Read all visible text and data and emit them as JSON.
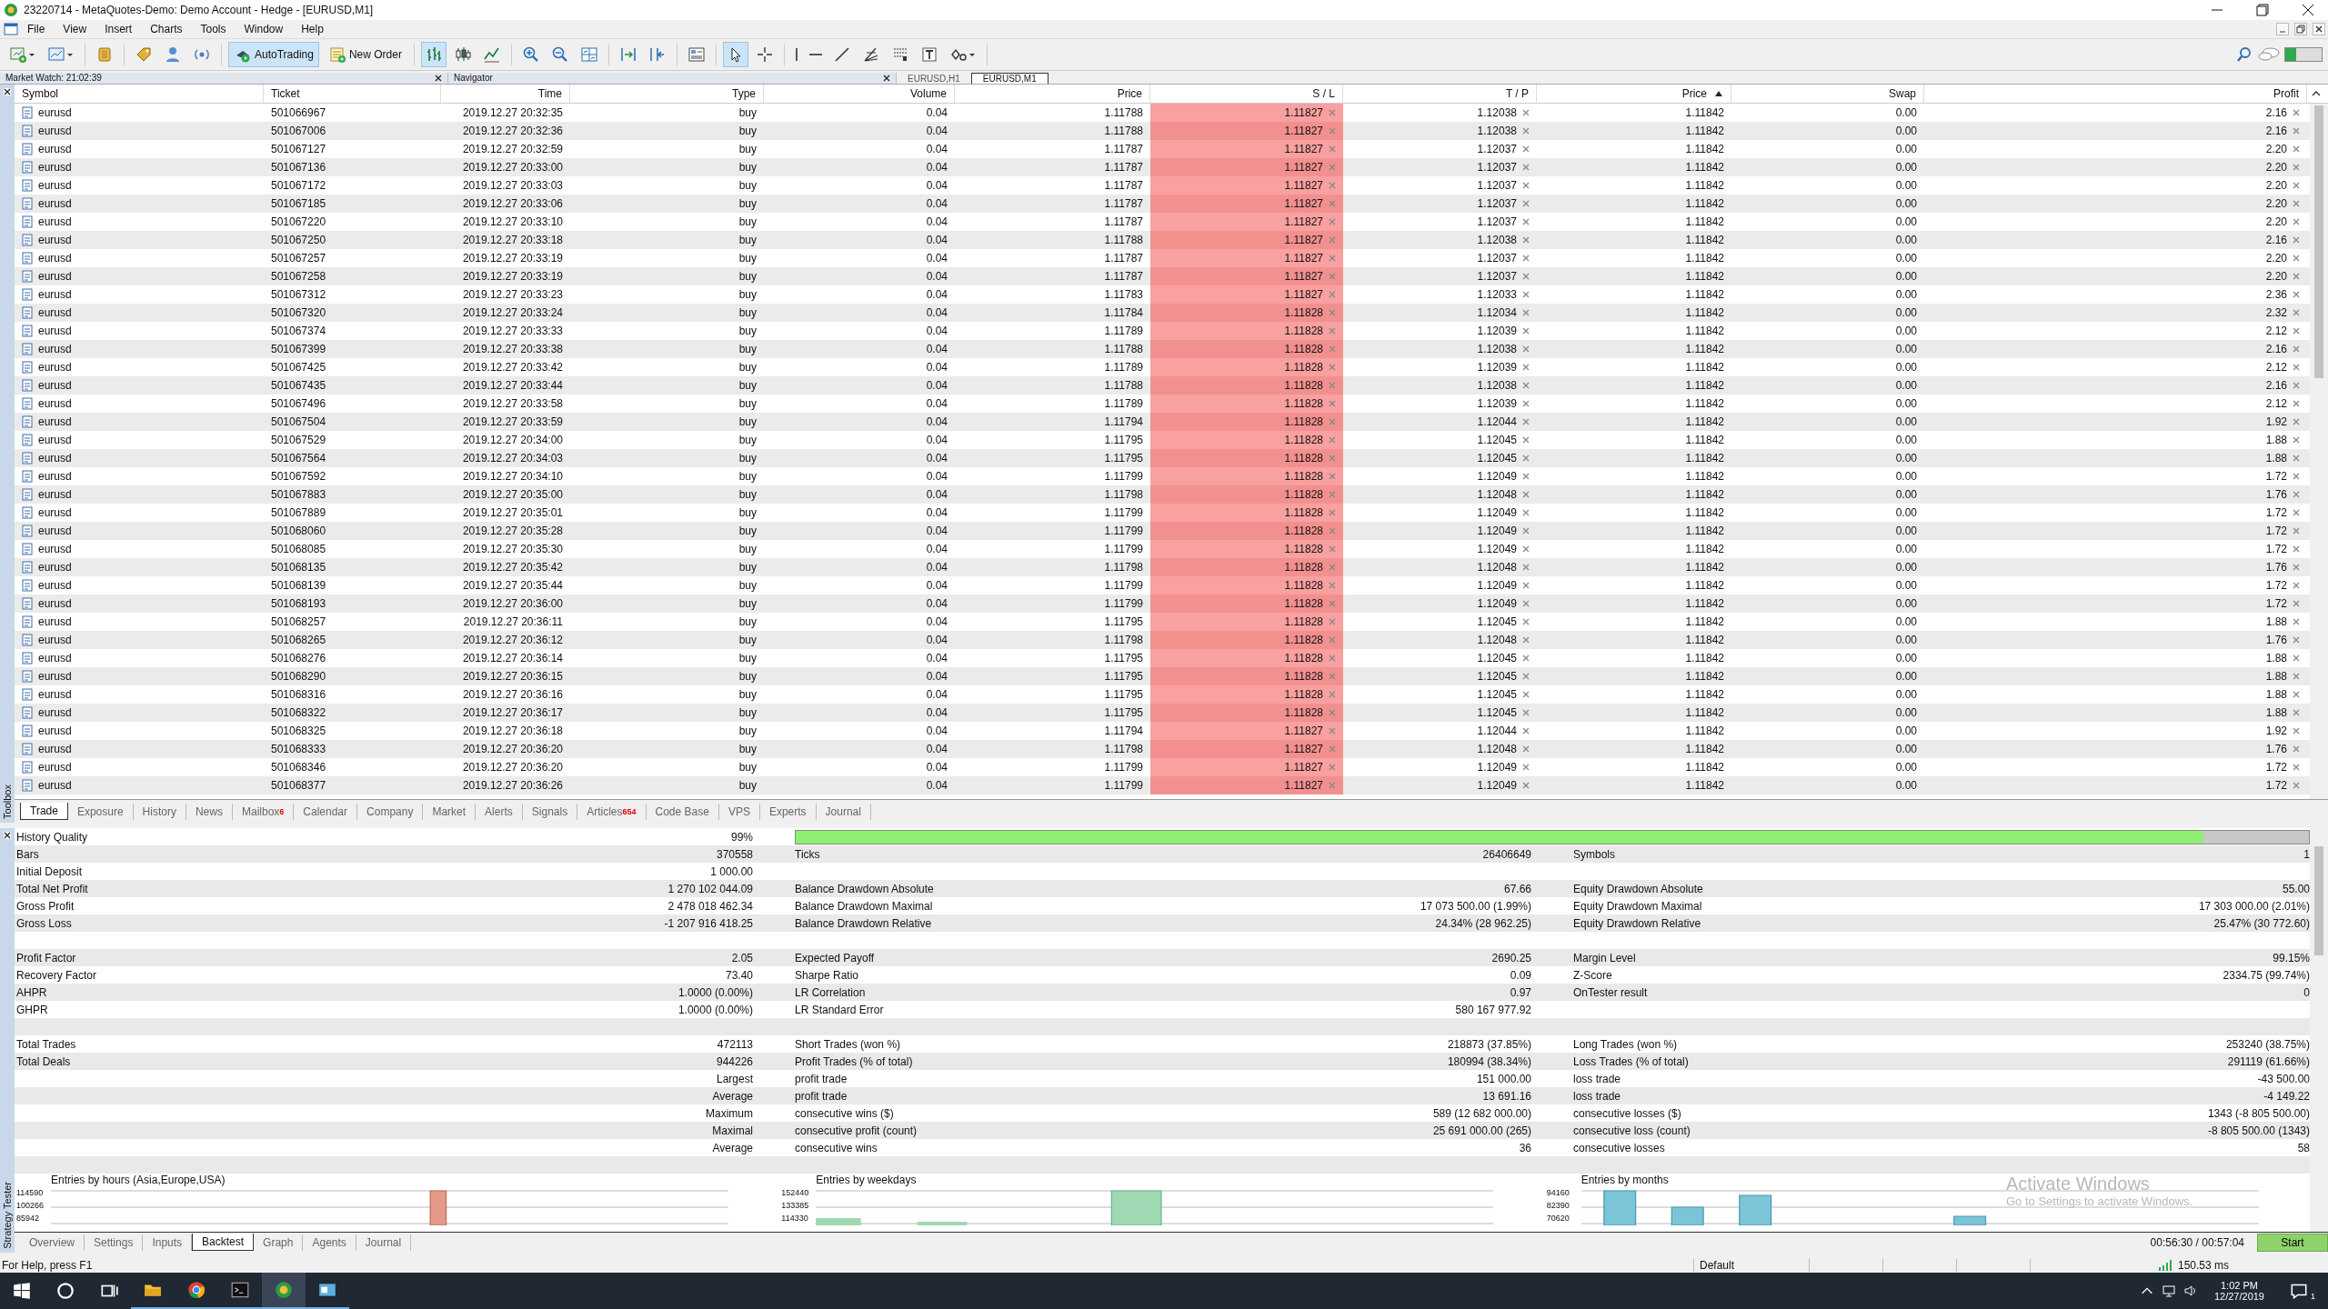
{
  "window": {
    "title": "23220714 - MetaQuotes-Demo: Demo Account - Hedge - [EURUSD,M1]"
  },
  "menu": [
    "File",
    "View",
    "Insert",
    "Charts",
    "Tools",
    "Window",
    "Help"
  ],
  "toolbar": [
    [
      {
        "kind": "icon",
        "selected": false
      },
      {
        "kind": "icon",
        "selected": false
      }
    ],
    [
      {
        "kind": "icon",
        "selected": false
      }
    ],
    [
      {
        "kind": "icon",
        "selected": false
      },
      {
        "kind": "icon",
        "selected": false
      },
      {
        "kind": "icon",
        "selected": false
      }
    ],
    [
      {
        "kind": "button",
        "label": "AutoTrading",
        "selected": true
      },
      {
        "kind": "button",
        "label": "New Order",
        "selected": false
      }
    ],
    [
      {
        "kind": "icon",
        "selected": true
      },
      {
        "kind": "icon",
        "selected": false
      },
      {
        "kind": "icon",
        "selected": false
      }
    ],
    [
      {
        "kind": "icon",
        "selected": false
      },
      {
        "kind": "icon",
        "selected": false
      },
      {
        "kind": "icon",
        "selected": false
      }
    ],
    [
      {
        "kind": "icon",
        "selected": false
      },
      {
        "kind": "icon",
        "selected": false
      }
    ],
    [
      {
        "kind": "icon",
        "selected": false
      }
    ],
    [
      {
        "kind": "icon",
        "selected": true
      },
      {
        "kind": "icon",
        "selected": false
      }
    ],
    [
      {
        "kind": "icon",
        "selected": false
      },
      {
        "kind": "icon",
        "selected": false
      },
      {
        "kind": "icon",
        "selected": false
      },
      {
        "kind": "icon",
        "selected": false
      },
      {
        "kind": "icon",
        "selected": false
      },
      {
        "kind": "icon",
        "selected": false
      },
      {
        "kind": "icon",
        "selected": false
      }
    ]
  ],
  "panels": [
    {
      "title": "Market Watch: 21:02:39"
    },
    {
      "title": "Navigator"
    }
  ],
  "chart_tabs": [
    {
      "label": "EURUSD,H1",
      "selected": false
    },
    {
      "label": "EURUSD,M1",
      "selected": true
    }
  ],
  "side_labels": {
    "toolbox": "Toolbox",
    "tester": "Strategy Tester"
  },
  "columns": [
    {
      "label": "Symbol",
      "sorted": false,
      "highlighted": false,
      "clear_button": false
    },
    {
      "label": "Ticket",
      "sorted": false,
      "highlighted": false,
      "clear_button": false
    },
    {
      "label": "Time",
      "sorted": false,
      "highlighted": false,
      "clear_button": false
    },
    {
      "label": "Type",
      "sorted": false,
      "highlighted": false,
      "clear_button": false
    },
    {
      "label": "Volume",
      "sorted": false,
      "highlighted": false,
      "clear_button": false
    },
    {
      "label": "Price",
      "sorted": false,
      "highlighted": false,
      "clear_button": false
    },
    {
      "label": "S / L",
      "sorted": false,
      "highlighted": true,
      "clear_button": true
    },
    {
      "label": "T / P",
      "sorted": false,
      "highlighted": false,
      "clear_button": true
    },
    {
      "label": "Price",
      "sorted": true,
      "highlighted": false,
      "clear_button": false
    },
    {
      "label": "Swap",
      "sorted": false,
      "highlighted": false,
      "clear_button": false
    },
    {
      "label": "Profit",
      "sorted": false,
      "highlighted": false,
      "clear_button": true
    }
  ],
  "rows": [
    [
      "eurusd",
      "501066967",
      "2019.12.27 20:32:35",
      "buy",
      "0.04",
      "1.11788",
      "1.11827",
      "1.12038",
      "1.11842",
      "0.00",
      "2.16"
    ],
    [
      "eurusd",
      "501067006",
      "2019.12.27 20:32:36",
      "buy",
      "0.04",
      "1.11788",
      "1.11827",
      "1.12038",
      "1.11842",
      "0.00",
      "2.16"
    ],
    [
      "eurusd",
      "501067127",
      "2019.12.27 20:32:59",
      "buy",
      "0.04",
      "1.11787",
      "1.11827",
      "1.12037",
      "1.11842",
      "0.00",
      "2.20"
    ],
    [
      "eurusd",
      "501067136",
      "2019.12.27 20:33:00",
      "buy",
      "0.04",
      "1.11787",
      "1.11827",
      "1.12037",
      "1.11842",
      "0.00",
      "2.20"
    ],
    [
      "eurusd",
      "501067172",
      "2019.12.27 20:33:03",
      "buy",
      "0.04",
      "1.11787",
      "1.11827",
      "1.12037",
      "1.11842",
      "0.00",
      "2.20"
    ],
    [
      "eurusd",
      "501067185",
      "2019.12.27 20:33:06",
      "buy",
      "0.04",
      "1.11787",
      "1.11827",
      "1.12037",
      "1.11842",
      "0.00",
      "2.20"
    ],
    [
      "eurusd",
      "501067220",
      "2019.12.27 20:33:10",
      "buy",
      "0.04",
      "1.11787",
      "1.11827",
      "1.12037",
      "1.11842",
      "0.00",
      "2.20"
    ],
    [
      "eurusd",
      "501067250",
      "2019.12.27 20:33:18",
      "buy",
      "0.04",
      "1.11788",
      "1.11827",
      "1.12038",
      "1.11842",
      "0.00",
      "2.16"
    ],
    [
      "eurusd",
      "501067257",
      "2019.12.27 20:33:19",
      "buy",
      "0.04",
      "1.11787",
      "1.11827",
      "1.12037",
      "1.11842",
      "0.00",
      "2.20"
    ],
    [
      "eurusd",
      "501067258",
      "2019.12.27 20:33:19",
      "buy",
      "0.04",
      "1.11787",
      "1.11827",
      "1.12037",
      "1.11842",
      "0.00",
      "2.20"
    ],
    [
      "eurusd",
      "501067312",
      "2019.12.27 20:33:23",
      "buy",
      "0.04",
      "1.11783",
      "1.11827",
      "1.12033",
      "1.11842",
      "0.00",
      "2.36"
    ],
    [
      "eurusd",
      "501067320",
      "2019.12.27 20:33:24",
      "buy",
      "0.04",
      "1.11784",
      "1.11828",
      "1.12034",
      "1.11842",
      "0.00",
      "2.32"
    ],
    [
      "eurusd",
      "501067374",
      "2019.12.27 20:33:33",
      "buy",
      "0.04",
      "1.11789",
      "1.11828",
      "1.12039",
      "1.11842",
      "0.00",
      "2.12"
    ],
    [
      "eurusd",
      "501067399",
      "2019.12.27 20:33:38",
      "buy",
      "0.04",
      "1.11788",
      "1.11828",
      "1.12038",
      "1.11842",
      "0.00",
      "2.16"
    ],
    [
      "eurusd",
      "501067425",
      "2019.12.27 20:33:42",
      "buy",
      "0.04",
      "1.11789",
      "1.11828",
      "1.12039",
      "1.11842",
      "0.00",
      "2.12"
    ],
    [
      "eurusd",
      "501067435",
      "2019.12.27 20:33:44",
      "buy",
      "0.04",
      "1.11788",
      "1.11828",
      "1.12038",
      "1.11842",
      "0.00",
      "2.16"
    ],
    [
      "eurusd",
      "501067496",
      "2019.12.27 20:33:58",
      "buy",
      "0.04",
      "1.11789",
      "1.11828",
      "1.12039",
      "1.11842",
      "0.00",
      "2.12"
    ],
    [
      "eurusd",
      "501067504",
      "2019.12.27 20:33:59",
      "buy",
      "0.04",
      "1.11794",
      "1.11828",
      "1.12044",
      "1.11842",
      "0.00",
      "1.92"
    ],
    [
      "eurusd",
      "501067529",
      "2019.12.27 20:34:00",
      "buy",
      "0.04",
      "1.11795",
      "1.11828",
      "1.12045",
      "1.11842",
      "0.00",
      "1.88"
    ],
    [
      "eurusd",
      "501067564",
      "2019.12.27 20:34:03",
      "buy",
      "0.04",
      "1.11795",
      "1.11828",
      "1.12045",
      "1.11842",
      "0.00",
      "1.88"
    ],
    [
      "eurusd",
      "501067592",
      "2019.12.27 20:34:10",
      "buy",
      "0.04",
      "1.11799",
      "1.11828",
      "1.12049",
      "1.11842",
      "0.00",
      "1.72"
    ],
    [
      "eurusd",
      "501067883",
      "2019.12.27 20:35:00",
      "buy",
      "0.04",
      "1.11798",
      "1.11828",
      "1.12048",
      "1.11842",
      "0.00",
      "1.76"
    ],
    [
      "eurusd",
      "501067889",
      "2019.12.27 20:35:01",
      "buy",
      "0.04",
      "1.11799",
      "1.11828",
      "1.12049",
      "1.11842",
      "0.00",
      "1.72"
    ],
    [
      "eurusd",
      "501068060",
      "2019.12.27 20:35:28",
      "buy",
      "0.04",
      "1.11799",
      "1.11828",
      "1.12049",
      "1.11842",
      "0.00",
      "1.72"
    ],
    [
      "eurusd",
      "501068085",
      "2019.12.27 20:35:30",
      "buy",
      "0.04",
      "1.11799",
      "1.11828",
      "1.12049",
      "1.11842",
      "0.00",
      "1.72"
    ],
    [
      "eurusd",
      "501068135",
      "2019.12.27 20:35:42",
      "buy",
      "0.04",
      "1.11798",
      "1.11828",
      "1.12048",
      "1.11842",
      "0.00",
      "1.76"
    ],
    [
      "eurusd",
      "501068139",
      "2019.12.27 20:35:44",
      "buy",
      "0.04",
      "1.11799",
      "1.11828",
      "1.12049",
      "1.11842",
      "0.00",
      "1.72"
    ],
    [
      "eurusd",
      "501068193",
      "2019.12.27 20:36:00",
      "buy",
      "0.04",
      "1.11799",
      "1.11828",
      "1.12049",
      "1.11842",
      "0.00",
      "1.72"
    ],
    [
      "eurusd",
      "501068257",
      "2019.12.27 20:36:11",
      "buy",
      "0.04",
      "1.11795",
      "1.11828",
      "1.12045",
      "1.11842",
      "0.00",
      "1.88"
    ],
    [
      "eurusd",
      "501068265",
      "2019.12.27 20:36:12",
      "buy",
      "0.04",
      "1.11798",
      "1.11828",
      "1.12048",
      "1.11842",
      "0.00",
      "1.76"
    ],
    [
      "eurusd",
      "501068276",
      "2019.12.27 20:36:14",
      "buy",
      "0.04",
      "1.11795",
      "1.11828",
      "1.12045",
      "1.11842",
      "0.00",
      "1.88"
    ],
    [
      "eurusd",
      "501068290",
      "2019.12.27 20:36:15",
      "buy",
      "0.04",
      "1.11795",
      "1.11828",
      "1.12045",
      "1.11842",
      "0.00",
      "1.88"
    ],
    [
      "eurusd",
      "501068316",
      "2019.12.27 20:36:16",
      "buy",
      "0.04",
      "1.11795",
      "1.11828",
      "1.12045",
      "1.11842",
      "0.00",
      "1.88"
    ],
    [
      "eurusd",
      "501068322",
      "2019.12.27 20:36:17",
      "buy",
      "0.04",
      "1.11795",
      "1.11828",
      "1.12045",
      "1.11842",
      "0.00",
      "1.88"
    ],
    [
      "eurusd",
      "501068325",
      "2019.12.27 20:36:18",
      "buy",
      "0.04",
      "1.11794",
      "1.11827",
      "1.12044",
      "1.11842",
      "0.00",
      "1.92"
    ],
    [
      "eurusd",
      "501068333",
      "2019.12.27 20:36:20",
      "buy",
      "0.04",
      "1.11798",
      "1.11827",
      "1.12048",
      "1.11842",
      "0.00",
      "1.76"
    ],
    [
      "eurusd",
      "501068346",
      "2019.12.27 20:36:20",
      "buy",
      "0.04",
      "1.11799",
      "1.11827",
      "1.12049",
      "1.11842",
      "0.00",
      "1.72"
    ],
    [
      "eurusd",
      "501068377",
      "2019.12.27 20:36:26",
      "buy",
      "0.04",
      "1.11799",
      "1.11827",
      "1.12049",
      "1.11842",
      "0.00",
      "1.72"
    ]
  ],
  "toolbox_tabs": [
    {
      "label": "Trade",
      "selected": true
    },
    {
      "label": "Exposure",
      "selected": false
    },
    {
      "label": "History",
      "selected": false
    },
    {
      "label": "News",
      "selected": false
    },
    {
      "label": "Mailbox",
      "badge": "6",
      "selected": false
    },
    {
      "label": "Calendar",
      "selected": false
    },
    {
      "label": "Company",
      "selected": false
    },
    {
      "label": "Market",
      "selected": false
    },
    {
      "label": "Alerts",
      "selected": false
    },
    {
      "label": "Signals",
      "selected": false
    },
    {
      "label": "Articles",
      "badge": "654",
      "selected": false
    },
    {
      "label": "Code Base",
      "selected": false
    },
    {
      "label": "VPS",
      "selected": false
    },
    {
      "label": "Experts",
      "selected": false
    },
    {
      "label": "Journal",
      "selected": false
    }
  ],
  "stats": [
    {
      "kind": "quality",
      "l1": "History Quality",
      "v1": "99%",
      "level": 0.93
    },
    {
      "kind": "data",
      "l1": "Bars",
      "v1": "370558",
      "l2": "Ticks",
      "v2": "26406649",
      "l3": "Symbols",
      "v3": "1"
    },
    {
      "kind": "data",
      "l1": "Initial Deposit",
      "v1": "1 000.00"
    },
    {
      "kind": "data",
      "l1": "Total Net Profit",
      "v1": "1 270 102 044.09",
      "l2": "Balance Drawdown Absolute",
      "v2": "67.66",
      "l3": "Equity Drawdown Absolute",
      "v3": "55.00"
    },
    {
      "kind": "data",
      "l1": "Gross Profit",
      "v1": "2 478 018 462.34",
      "l2": "Balance Drawdown Maximal",
      "v2": "17 073 500.00 (1.99%)",
      "l3": "Equity Drawdown Maximal",
      "v3": "17 303 000.00 (2.01%)"
    },
    {
      "kind": "data",
      "l1": "Gross Loss",
      "v1": "-1 207 916 418.25",
      "l2": "Balance Drawdown Relative",
      "v2": "24.34% (28 962.25)",
      "l3": "Equity Drawdown Relative",
      "v3": "25.47% (30 772.60)"
    },
    {
      "kind": "spacer"
    },
    {
      "kind": "data",
      "l1": "Profit Factor",
      "v1": "2.05",
      "l2": "Expected Payoff",
      "v2": "2690.25",
      "l3": "Margin Level",
      "v3": "99.15%"
    },
    {
      "kind": "data",
      "l1": "Recovery Factor",
      "v1": "73.40",
      "l2": "Sharpe Ratio",
      "v2": "0.09",
      "l3": "Z-Score",
      "v3": "2334.75 (99.74%)"
    },
    {
      "kind": "data",
      "l1": "AHPR",
      "v1": "1.0000 (0.00%)",
      "l2": "LR Correlation",
      "v2": "0.97",
      "l3": "OnTester result",
      "v3": "0"
    },
    {
      "kind": "data",
      "l1": "GHPR",
      "v1": "1.0000 (0.00%)",
      "l2": "LR Standard Error",
      "v2": "580 167 977.92"
    },
    {
      "kind": "spacer"
    },
    {
      "kind": "data",
      "l1": "Total Trades",
      "v1": "472113",
      "l2": "Short Trades (won %)",
      "v2": "218873 (37.85%)",
      "l3": "Long Trades (won %)",
      "v3": "253240 (38.75%)"
    },
    {
      "kind": "data",
      "l1": "Total Deals",
      "v1": "944226",
      "l2": "Profit Trades (% of total)",
      "v2": "180994 (38.34%)",
      "l3": "Loss Trades (% of total)",
      "v3": "291119 (61.66%)"
    },
    {
      "kind": "data",
      "v1": "Largest",
      "l2": "profit trade",
      "v2": "151 000.00",
      "l3": "loss trade",
      "v3": "-43 500.00"
    },
    {
      "kind": "data",
      "v1": "Average",
      "l2": "profit trade",
      "v2": "13 691.16",
      "l3": "loss trade",
      "v3": "-4 149.22"
    },
    {
      "kind": "data",
      "v1": "Maximum",
      "l2": "consecutive wins ($)",
      "v2": "589 (12 682 000.00)",
      "l3": "consecutive losses ($)",
      "v3": "1343 (-8 805 500.00)"
    },
    {
      "kind": "data",
      "v1": "Maximal",
      "l2": "consecutive profit (count)",
      "v2": "25 691 000.00 (265)",
      "l3": "consecutive loss (count)",
      "v3": "-8 805 500.00 (1343)"
    },
    {
      "kind": "data",
      "v1": "Average",
      "l2": "consecutive wins",
      "v2": "36",
      "l3": "consecutive losses",
      "v3": "58"
    },
    {
      "kind": "spacer"
    }
  ],
  "mini_charts": [
    {
      "title": "Entries by hours (Asia,Europe,USA)",
      "ticks": [
        "114590",
        "100266",
        "85942"
      ]
    },
    {
      "title": "Entries by weekdays",
      "ticks": [
        "152440",
        "133385",
        "114330"
      ]
    },
    {
      "title": "Entries by months",
      "ticks": [
        "94160",
        "82390",
        "70620"
      ]
    }
  ],
  "os_notice": {
    "title": "Activate Windows",
    "text": "Go to Settings to activate Windows."
  },
  "tester_tabs": [
    {
      "label": "Overview",
      "selected": false
    },
    {
      "label": "Settings",
      "selected": false
    },
    {
      "label": "Inputs",
      "selected": false
    },
    {
      "label": "Backtest",
      "selected": true
    },
    {
      "label": "Graph",
      "selected": false
    },
    {
      "label": "Agents",
      "selected": false
    },
    {
      "label": "Journal",
      "selected": false
    }
  ],
  "tester_time": "00:56:30 / 00:57:04",
  "start_button": "Start",
  "status_bar": {
    "help": "For Help, press F1",
    "profile": "Default",
    "ping": "150.53 ms"
  },
  "taskbar": {
    "time": "1:02 PM",
    "date": "12/27/2019",
    "notifications": "1"
  }
}
